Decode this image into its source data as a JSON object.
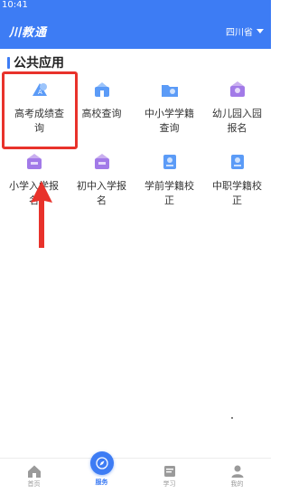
{
  "status_bar": {
    "time": "10:41"
  },
  "header": {
    "app_name": "川教通",
    "region": "四川省"
  },
  "section": {
    "title": "公共应用"
  },
  "apps": [
    {
      "label": "高考成绩查询",
      "icon": "exam-score-icon"
    },
    {
      "label": "高校查询",
      "icon": "university-icon"
    },
    {
      "label": "中小学学籍查询",
      "icon": "student-record-icon"
    },
    {
      "label": "幼儿园入园报名",
      "icon": "kindergarten-icon"
    },
    {
      "label": "小学入学报名",
      "icon": "primary-enroll-icon"
    },
    {
      "label": "初中入学报名",
      "icon": "junior-enroll-icon"
    },
    {
      "label": "学前学籍校正",
      "icon": "preschool-correct-icon"
    },
    {
      "label": "中职学籍校正",
      "icon": "vocational-correct-icon"
    }
  ],
  "tabs": [
    {
      "label": "首页",
      "icon": "home-icon"
    },
    {
      "label": "服务",
      "icon": "compass-icon",
      "active": true
    },
    {
      "label": "学习",
      "icon": "book-icon"
    },
    {
      "label": "我的",
      "icon": "person-icon"
    }
  ],
  "colors": {
    "brand": "#3d7cf4",
    "highlight": "#e8322b",
    "purple": "#a27ae8"
  }
}
